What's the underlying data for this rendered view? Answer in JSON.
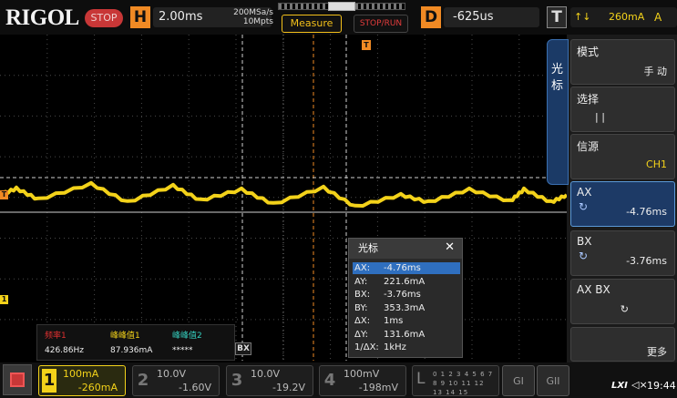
{
  "brand": {
    "logo": "RIGOL",
    "run_state": "STOP"
  },
  "horizontal": {
    "icon": "H",
    "timebase": "2.00ms",
    "rate_line1": "200MSa/s",
    "rate_line2": "10Mpts"
  },
  "delay": {
    "icon": "D",
    "value": "-625us"
  },
  "trigger": {
    "icon": "T",
    "channel": "↑↓",
    "level": "260mA",
    "mode": "A"
  },
  "toolbar": {
    "measure": "Measure",
    "stoprun": "STOP/RUN"
  },
  "side_tab": {
    "label": "光标"
  },
  "menu": {
    "mode": {
      "label": "模式",
      "value": "手 动"
    },
    "select": {
      "label": "选择",
      "value": "|   |"
    },
    "source": {
      "label": "信源",
      "value": "CH1"
    },
    "ax": {
      "label": "AX",
      "value": "-4.76ms"
    },
    "bx": {
      "label": "BX",
      "value": "-3.76ms"
    },
    "axbx": {
      "label": "AX BX",
      "value": "↻"
    },
    "more": {
      "label": "更多"
    }
  },
  "cursor_popup": {
    "title": "光标",
    "close": "✕",
    "rows": [
      {
        "k": "AX:",
        "v": "-4.76ms"
      },
      {
        "k": "AY:",
        "v": "221.6mA"
      },
      {
        "k": "BX:",
        "v": "-3.76ms"
      },
      {
        "k": "BY:",
        "v": "353.3mA"
      },
      {
        "k": "ΔX:",
        "v": "1ms"
      },
      {
        "k": "ΔY:",
        "v": "131.6mA"
      },
      {
        "k": "1/ΔX:",
        "v": "1kHz"
      }
    ]
  },
  "measurements": [
    {
      "label": "频率1",
      "value": "426.86Hz",
      "color": "#e03030"
    },
    {
      "label": "峰峰值1",
      "value": "87.936mA",
      "color": "#f3d21a"
    },
    {
      "label": "峰峰值2",
      "value": "*****",
      "color": "#35d0c0"
    }
  ],
  "markers": {
    "bx": "BX",
    "trig": "T"
  },
  "channels": [
    {
      "num": "1",
      "scale": "100mA",
      "offset": "-260mA",
      "color": "#f3d21a"
    },
    {
      "num": "2",
      "scale": "10.0V",
      "offset": "-1.60V",
      "color": "#888888"
    },
    {
      "num": "3",
      "scale": "10.0V",
      "offset": "-19.2V",
      "color": "#888888"
    },
    {
      "num": "4",
      "scale": "100mV",
      "offset": "-198mV",
      "color": "#888888"
    }
  ],
  "logic": {
    "icon": "L",
    "digits": "0 1 2 3 4 5 6 7 8 9 10 11 12 13 14 15"
  },
  "generators": {
    "g1": "GI",
    "g2": "GII"
  },
  "status": {
    "lxi": "LXI",
    "speaker": "◁×",
    "time": "19:44"
  },
  "colors": {
    "ch1": "#f3d21a",
    "cursor_a": "#f08a24",
    "grid": "#555555",
    "accent": "#2f6fbf"
  }
}
